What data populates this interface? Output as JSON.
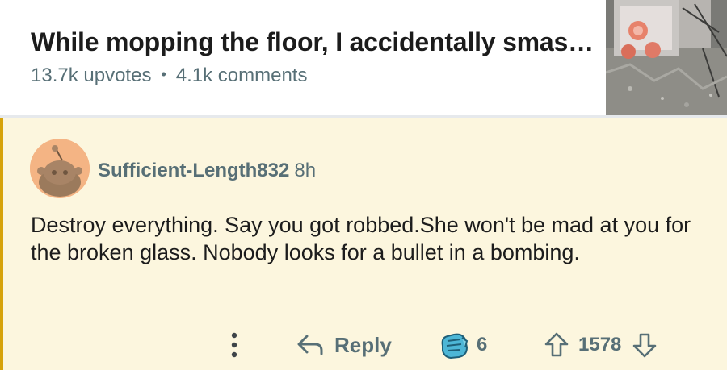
{
  "post": {
    "title": "While mopping the floor, I accidentally smas…",
    "upvotes": "13.7k upvotes",
    "separator": "•",
    "comments": "4.1k comments"
  },
  "comment": {
    "author": "Sufficient-Length832",
    "age": "8h",
    "body": "Destroy everything. Say you got robbed.She won't be mad at you for the broken glass. Nobody looks for a bullet in a bombing.",
    "actions": {
      "reply_label": "Reply",
      "award_count": "6",
      "vote_count": "1578"
    }
  },
  "colors": {
    "comment_background": "#fcf6de",
    "highlight_bar": "#d6a20a",
    "meta_text": "#576f76",
    "award_icon": "#2f8bb1"
  },
  "icons": {
    "more": "more-options-icon",
    "reply": "reply-arrow-icon",
    "award": "award-icon",
    "upvote": "upvote-arrow-icon",
    "downvote": "downvote-arrow-icon"
  }
}
